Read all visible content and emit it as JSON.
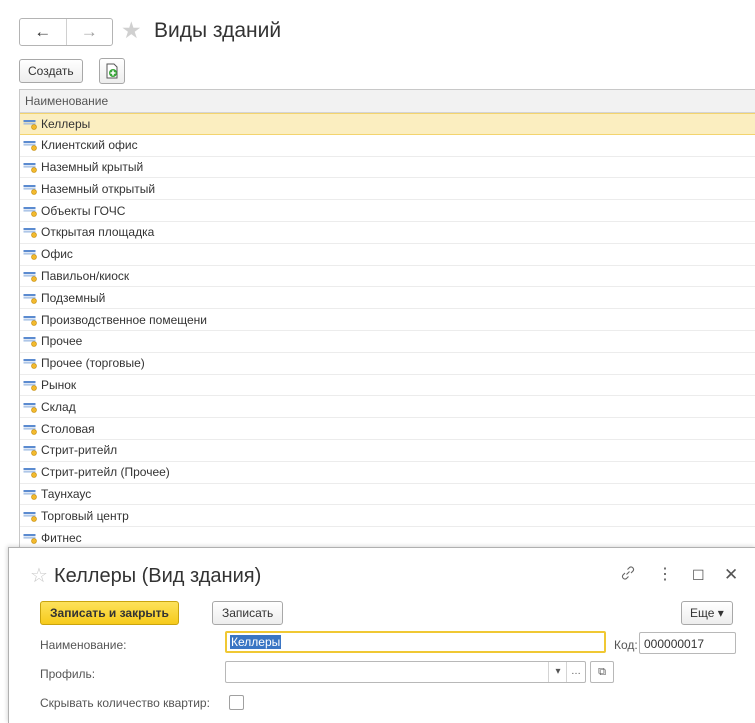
{
  "nav": {
    "back": "←",
    "forward": "→"
  },
  "list_window": {
    "title": "Виды зданий",
    "create_label": "Создать",
    "column_header": "Наименование",
    "items": [
      "Келлеры",
      "Клиентский офис",
      "Наземный крытый",
      "Наземный открытый",
      "Объекты ГОЧС",
      "Открытая площадка",
      "Офис",
      "Павильон/киоск",
      "Подземный",
      "Производственное помещени",
      "Прочее",
      "Прочее (торговые)",
      "Рынок",
      "Склад",
      "Столовая",
      "Стрит-ритейл",
      "Стрит-ритейл (Прочее)",
      "Таунхаус",
      "Торговый центр",
      "Фитнес"
    ],
    "selected_index": 0
  },
  "form_window": {
    "title": "Келлеры (Вид здания)",
    "save_close_label": "Записать и закрыть",
    "save_label": "Записать",
    "more_label": "Еще ▾",
    "name_label": "Наименование:",
    "name_value": "Келлеры",
    "code_label": "Код:",
    "code_value": "000000017",
    "profile_label": "Профиль:",
    "profile_value": "",
    "hide_flats_label": "Скрывать количество квартир:",
    "hide_flats_checked": false
  },
  "colors": {
    "accent_yellow": "#f6ca1b",
    "selection": "#fbeec0",
    "text_highlight": "#3a75c4"
  },
  "icons": {
    "list_item": "catalog-item-icon",
    "copy": "copy-document-icon",
    "favorite": "star-icon",
    "link": "link-icon",
    "menu": "kebab-menu-icon",
    "maximize": "maximize-icon",
    "close": "close-icon"
  }
}
